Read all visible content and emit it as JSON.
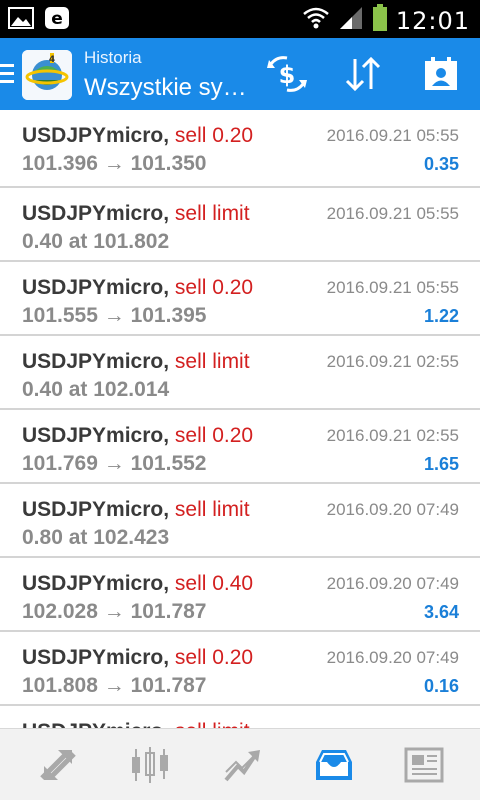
{
  "status_bar": {
    "time": "12:01",
    "icons": [
      "image-icon",
      "e-icon",
      "wifi-icon",
      "signal-icon",
      "battery-icon"
    ]
  },
  "app_bar": {
    "subtitle": "Historia",
    "title": "Wszystkie sy…",
    "actions": [
      "balance-filter-icon",
      "sort-icon",
      "calendar-icon"
    ],
    "brand_color": "#1a8ae8"
  },
  "colors": {
    "action_red": "#d32020",
    "profit_blue": "#1a7fd8",
    "gray_text": "#8a8a8a"
  },
  "history": [
    {
      "symbol": "USDJPYmicro",
      "action": "sell 0.20",
      "detail": "101.396 → 101.350",
      "date": "2016.09.21 05:55",
      "profit": "0.35"
    },
    {
      "symbol": "USDJPYmicro",
      "action": "sell limit",
      "detail": "0.40 at 101.802",
      "date": "2016.09.21 05:55",
      "profit": ""
    },
    {
      "symbol": "USDJPYmicro",
      "action": "sell 0.20",
      "detail": "101.555 → 101.395",
      "date": "2016.09.21 05:55",
      "profit": "1.22"
    },
    {
      "symbol": "USDJPYmicro",
      "action": "sell limit",
      "detail": "0.40 at 102.014",
      "date": "2016.09.21 02:55",
      "profit": ""
    },
    {
      "symbol": "USDJPYmicro",
      "action": "sell 0.20",
      "detail": "101.769 → 101.552",
      "date": "2016.09.21 02:55",
      "profit": "1.65"
    },
    {
      "symbol": "USDJPYmicro",
      "action": "sell limit",
      "detail": "0.80 at 102.423",
      "date": "2016.09.20 07:49",
      "profit": ""
    },
    {
      "symbol": "USDJPYmicro",
      "action": "sell 0.40",
      "detail": "102.028 → 101.787",
      "date": "2016.09.20 07:49",
      "profit": "3.64"
    },
    {
      "symbol": "USDJPYmicro",
      "action": "sell 0.20",
      "detail": "101.808 → 101.787",
      "date": "2016.09.20 07:49",
      "profit": "0.16"
    },
    {
      "symbol": "USDJPYmicro",
      "action": "sell limit",
      "detail": "",
      "date": "",
      "profit": ""
    }
  ],
  "bottom_nav": {
    "items": [
      "quotes-icon",
      "chart-icon",
      "trade-icon",
      "history-icon",
      "news-icon"
    ],
    "active_index": 3
  }
}
